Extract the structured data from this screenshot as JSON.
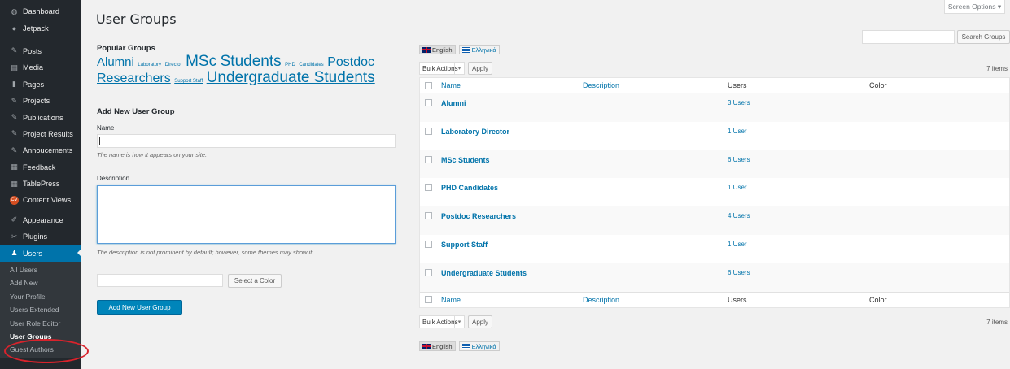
{
  "sidebar": {
    "items": [
      {
        "label": "Dashboard",
        "icon": "dashboard-icon",
        "glyph": "◍"
      },
      {
        "label": "Jetpack",
        "icon": "jetpack-icon",
        "glyph": "●"
      },
      {
        "label": "Posts",
        "icon": "pin-icon",
        "glyph": "✎"
      },
      {
        "label": "Media",
        "icon": "media-icon",
        "glyph": "▤"
      },
      {
        "label": "Pages",
        "icon": "pages-icon",
        "glyph": "▮"
      },
      {
        "label": "Projects",
        "icon": "pin-icon",
        "glyph": "✎"
      },
      {
        "label": "Publications",
        "icon": "pin-icon",
        "glyph": "✎"
      },
      {
        "label": "Project Results",
        "icon": "pin-icon",
        "glyph": "✎"
      },
      {
        "label": "Annoucements",
        "icon": "pin-icon",
        "glyph": "✎"
      },
      {
        "label": "Feedback",
        "icon": "feedback-icon",
        "glyph": "▦"
      },
      {
        "label": "TablePress",
        "icon": "table-icon",
        "glyph": "▦"
      },
      {
        "label": "Content Views",
        "icon": "content-views-icon",
        "glyph": "CV"
      },
      {
        "label": "Appearance",
        "icon": "appearance-icon",
        "glyph": "✐"
      },
      {
        "label": "Plugins",
        "icon": "plugins-icon",
        "glyph": "✂"
      },
      {
        "label": "Users",
        "icon": "users-icon",
        "glyph": "♟"
      }
    ],
    "submenu": [
      "All Users",
      "Add New",
      "Your Profile",
      "Users Extended",
      "User Role Editor",
      "User Groups",
      "Guest Authors"
    ]
  },
  "header": {
    "title": "User Groups",
    "screen_options": "Screen Options ▾"
  },
  "popular": {
    "title": "Popular Groups",
    "tags": [
      {
        "label": "Alumni",
        "size": 15
      },
      {
        "label": "Laboratory",
        "size": 6
      },
      {
        "label": "Director",
        "size": 6
      },
      {
        "label": "MSc",
        "size": 19
      },
      {
        "label": "Students",
        "size": 19
      },
      {
        "label": "PHD",
        "size": 6
      },
      {
        "label": "Candidates",
        "size": 6
      },
      {
        "label": "Postdoc",
        "size": 16
      },
      {
        "label": "Researchers",
        "size": 16
      },
      {
        "label": "Support Staff",
        "size": 6
      },
      {
        "label": "Undergraduate Students",
        "size": 19
      }
    ]
  },
  "form": {
    "title": "Add New User Group",
    "name_label": "Name",
    "name_hint": "The name is how it appears on your site.",
    "desc_label": "Description",
    "desc_hint": "The description is not prominent by default; however, some themes may show it.",
    "color_button": "Select a Color",
    "submit": "Add New User Group"
  },
  "search": {
    "button": "Search Groups"
  },
  "lang": {
    "english": "English",
    "greek": "Ελληνικά"
  },
  "bulk": {
    "label": "Bulk Actions",
    "apply": "Apply",
    "count": "7 items"
  },
  "table": {
    "columns": {
      "name": "Name",
      "description": "Description",
      "users": "Users",
      "color": "Color"
    },
    "rows": [
      {
        "name": "Alumni",
        "description": "",
        "users": "3 Users"
      },
      {
        "name": "Laboratory Director",
        "description": "",
        "users": "1 User"
      },
      {
        "name": "MSc Students",
        "description": "",
        "users": "6 Users"
      },
      {
        "name": "PHD Candidates",
        "description": "",
        "users": "1 User"
      },
      {
        "name": "Postdoc Researchers",
        "description": "",
        "users": "4 Users"
      },
      {
        "name": "Support Staff",
        "description": "",
        "users": "1 User"
      },
      {
        "name": "Undergraduate Students",
        "description": "",
        "users": "6 Users"
      }
    ]
  }
}
